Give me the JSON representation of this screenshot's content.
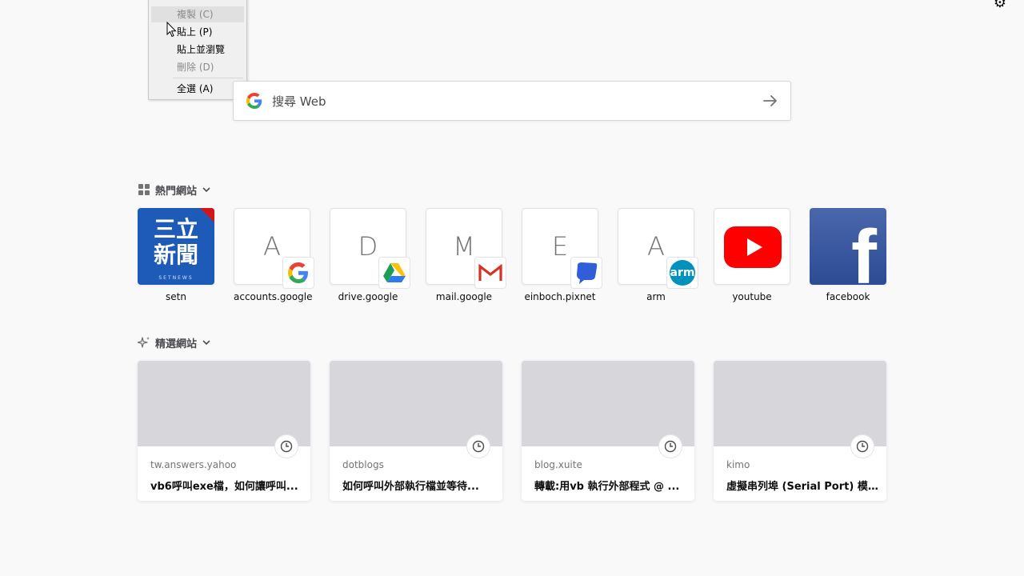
{
  "context_menu": {
    "items": [
      {
        "label": "複製 (C)",
        "disabled": true,
        "highlight": true
      },
      {
        "label": "貼上 (P)",
        "disabled": false
      },
      {
        "label": "貼上並瀏覽",
        "disabled": false
      },
      {
        "label": "刪除 (D)",
        "disabled": true
      },
      {
        "label": "全選 (A)",
        "disabled": false
      }
    ]
  },
  "search": {
    "placeholder": "搜尋 Web"
  },
  "top_sites": {
    "title": "熱門網站",
    "items": [
      {
        "label": "setn",
        "kind": "image"
      },
      {
        "label": "accounts.google",
        "letter": "A",
        "badge": "google-icon"
      },
      {
        "label": "drive.google",
        "letter": "D",
        "badge": "drive-icon"
      },
      {
        "label": "mail.google",
        "letter": "M",
        "badge": "gmail-icon"
      },
      {
        "label": "einboch.pixnet",
        "letter": "E",
        "badge": "pixnet-icon"
      },
      {
        "label": "arm",
        "letter": "A",
        "badge": "arm-icon"
      },
      {
        "label": "youtube",
        "kind": "image"
      },
      {
        "label": "facebook",
        "kind": "image"
      }
    ],
    "setn_logo": {
      "line1": "三立",
      "line2": "新聞",
      "sub": "SETNEWS"
    },
    "arm_text": "arm",
    "facebook_letter": "f"
  },
  "highlights": {
    "title": "精選網站",
    "items": [
      {
        "host": "tw.answers.yahoo",
        "title": "vb6呼叫exe檔，如何讓呼叫..."
      },
      {
        "host": "dotblogs",
        "title": "如何呼叫外部執行檔並等待..."
      },
      {
        "host": "blog.xuite",
        "title": "轉載:用vb 執行外部程式 @ ..."
      },
      {
        "host": "kimo",
        "title": "虛擬串列埠 (Serial Port) 模..."
      }
    ]
  },
  "colors": {
    "background": "#f9f9fa",
    "thumb": "#d7d7db",
    "youtube_red": "#ff0000",
    "facebook_blue": "#3b5998",
    "setn_blue": "#1e5bb8"
  }
}
